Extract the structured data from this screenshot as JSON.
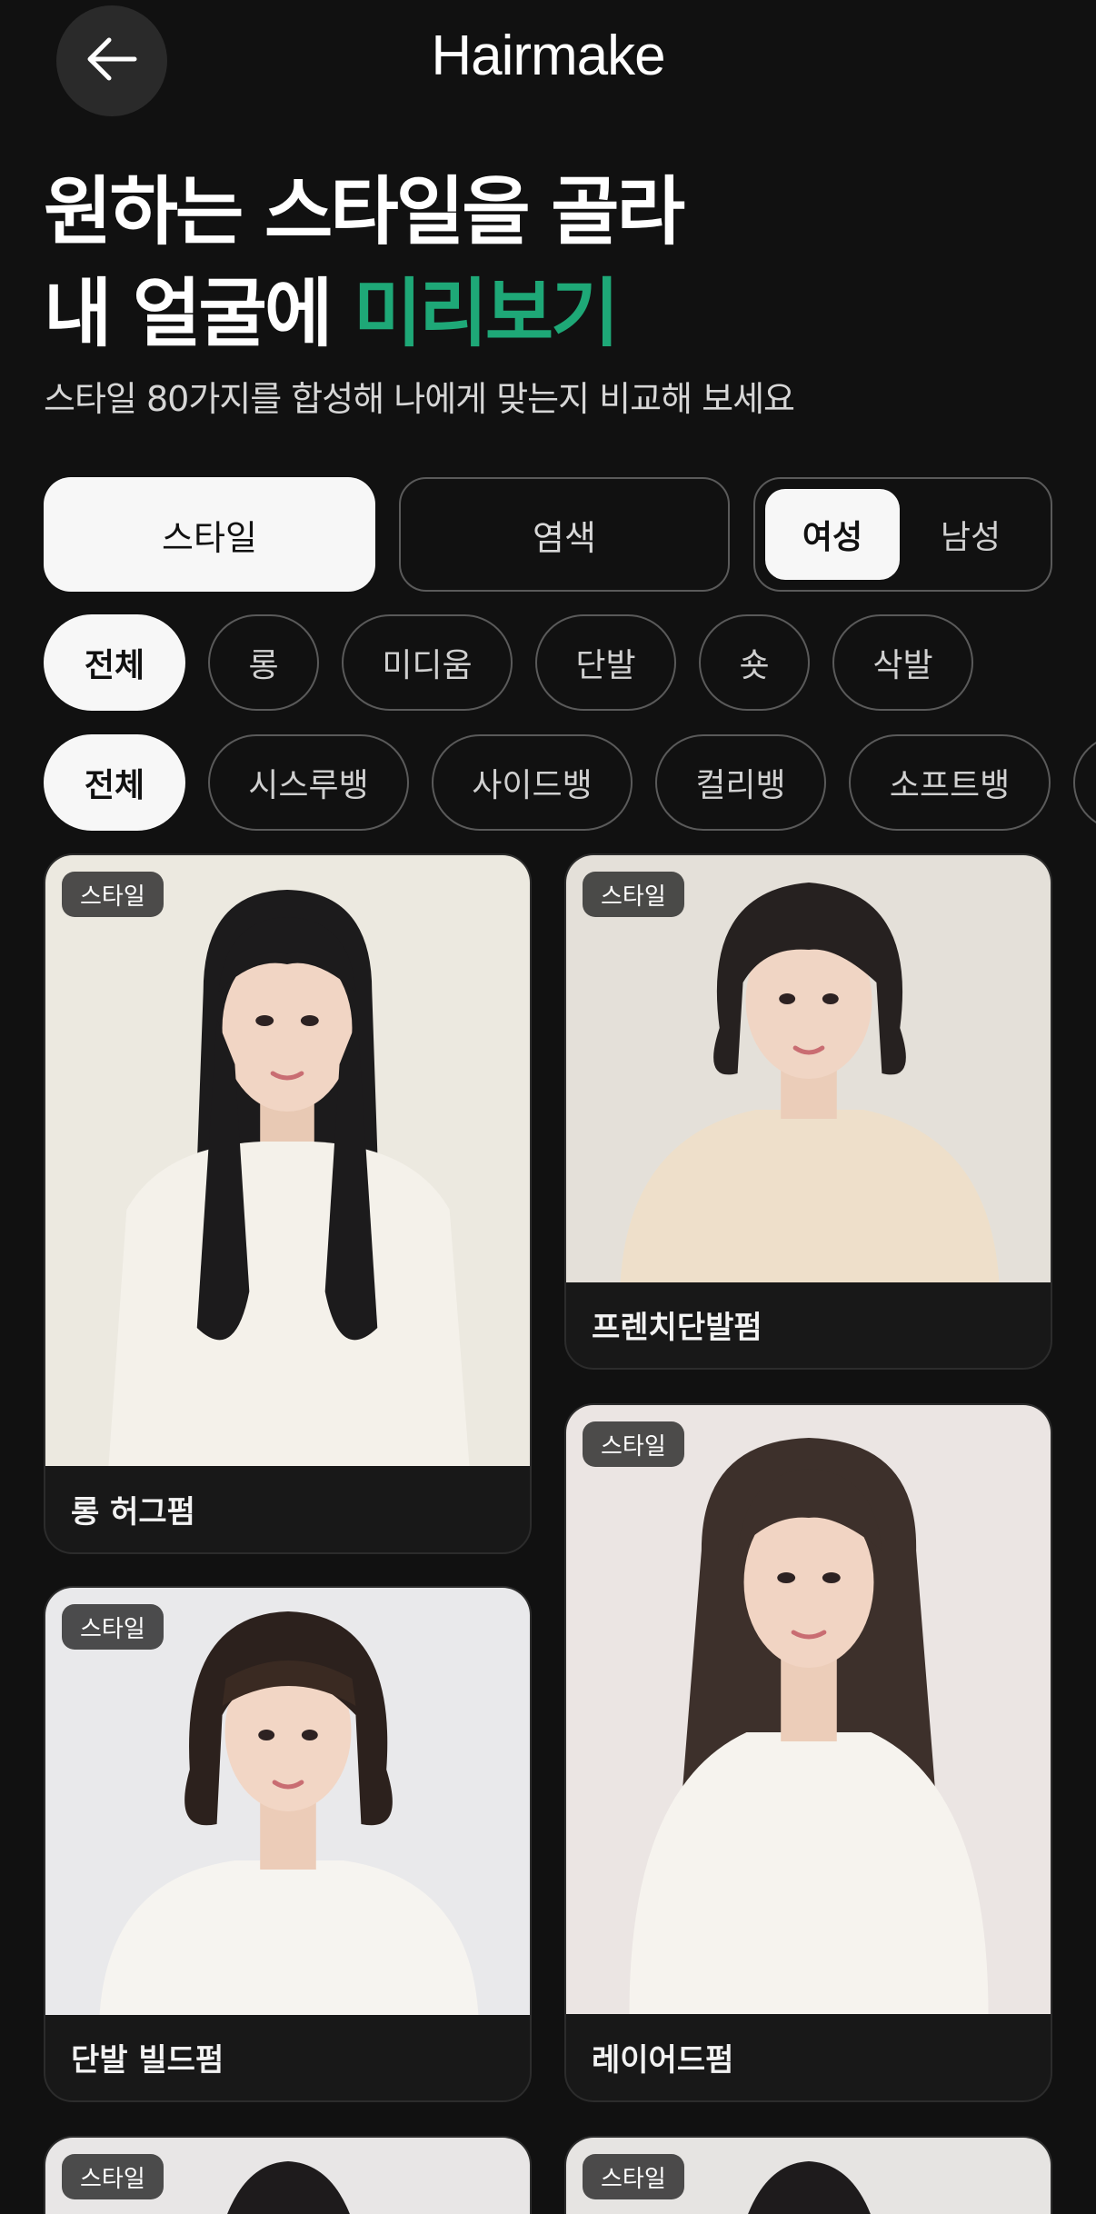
{
  "header": {
    "title": "Hairmake"
  },
  "hero": {
    "line1": "원하는 스타일을 골라",
    "line2_prefix": "내 얼굴에 ",
    "line2_accent": "미리보기",
    "subtitle": "스타일 80가지를 합성해 나에게 맞는지 비교해 보세요",
    "accent_color": "#1ea877"
  },
  "segments": {
    "style": "스타일",
    "color": "염색",
    "gender": {
      "female": "여성",
      "male": "남성",
      "selected": "여성"
    }
  },
  "length_filters": [
    "전체",
    "롱",
    "미디움",
    "단발",
    "숏",
    "삭발"
  ],
  "bangs_filters": [
    "전체",
    "시스루뱅",
    "사이드뱅",
    "컬리뱅",
    "소프트뱅"
  ],
  "cards": [
    {
      "badge": "스타일",
      "name": "롱 허그펌"
    },
    {
      "badge": "스타일",
      "name": "프렌치단발펌"
    },
    {
      "badge": "스타일",
      "name": "단발 빌드펌"
    },
    {
      "badge": "스타일",
      "name": "레이어드펌"
    },
    {
      "badge": "스타일",
      "name": ""
    },
    {
      "badge": "스타일",
      "name": ""
    }
  ]
}
